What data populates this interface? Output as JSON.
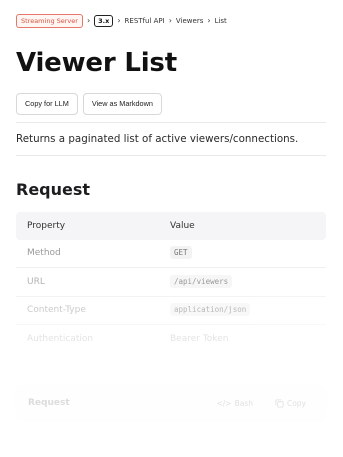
{
  "breadcrumb": {
    "badge": "Streaming Server",
    "version": "3.x",
    "items": [
      "RESTful API",
      "Viewers",
      "List"
    ]
  },
  "page": {
    "title": "Viewer List",
    "copy_llm": "Copy for LLM",
    "view_markdown": "View as Markdown",
    "description": "Returns a paginated list of active viewers/connections."
  },
  "request": {
    "heading": "Request",
    "headers": [
      "Property",
      "Value"
    ],
    "rows": [
      {
        "property": "Method",
        "value": "GET",
        "code": true
      },
      {
        "property": "URL",
        "value": "/api/viewers",
        "code": true
      },
      {
        "property": "Content-Type",
        "value": "application/json",
        "code": true
      },
      {
        "property": "Authentication",
        "value": "Bearer Token",
        "code": false
      }
    ]
  },
  "code_card": {
    "title": "Request",
    "language": "Bash",
    "copy": "Copy"
  },
  "colors": {
    "badge_accent": "#d9543f",
    "header_bg": "#f5f5f7"
  }
}
